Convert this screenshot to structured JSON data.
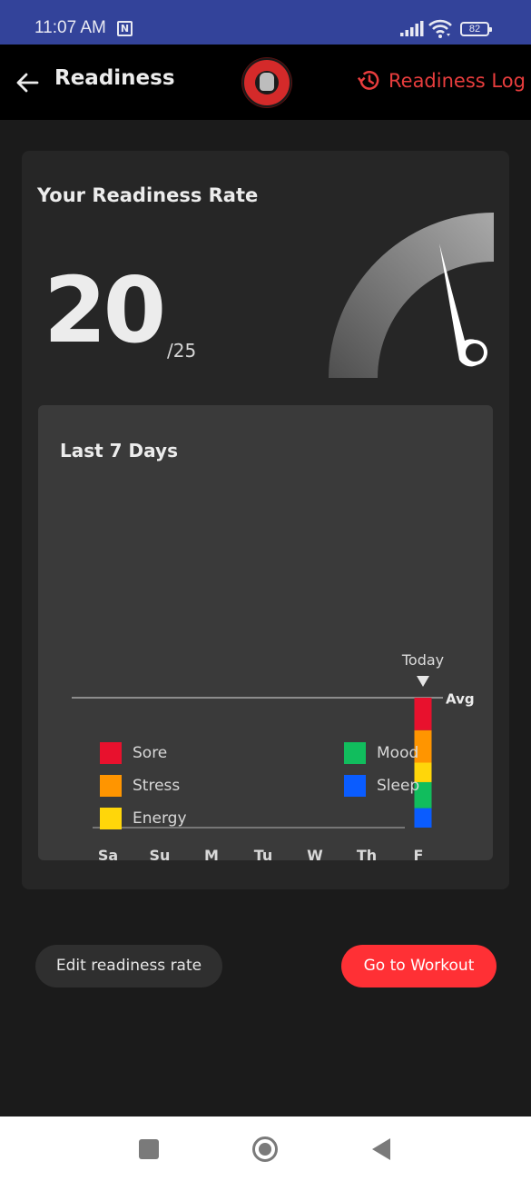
{
  "status_bar": {
    "time": "11:07 AM",
    "nfc_label": "N",
    "battery": "82"
  },
  "app_bar": {
    "title": "Readiness",
    "back_icon": "arrow-left-icon",
    "logo_alt": "Sweet Science of Fighting",
    "log_button": "Readiness Log",
    "log_icon": "history-icon",
    "accent_color": "#e83d3d"
  },
  "readiness": {
    "title": "Your Readiness Rate",
    "score": "20",
    "max_label": "/25",
    "score_value": 20,
    "max_value": 25
  },
  "chart_data": {
    "type": "bar",
    "title": "Last 7 Days",
    "categories": [
      "Sa",
      "Su",
      "M",
      "Tu",
      "W",
      "Th",
      "F"
    ],
    "stacked": true,
    "series": [
      {
        "name": "Sore",
        "color": "#e8112d",
        "values": [
          0,
          0,
          0,
          0,
          0,
          0,
          5
        ]
      },
      {
        "name": "Stress",
        "color": "#ff9500",
        "values": [
          0,
          0,
          0,
          0,
          0,
          0,
          5
        ]
      },
      {
        "name": "Energy",
        "color": "#ffd60a",
        "values": [
          0,
          0,
          0,
          0,
          0,
          0,
          3
        ]
      },
      {
        "name": "Mood",
        "color": "#11bd5d",
        "values": [
          0,
          0,
          0,
          0,
          0,
          0,
          4
        ]
      },
      {
        "name": "Sleep",
        "color": "#0a5cff",
        "values": [
          0,
          0,
          0,
          0,
          0,
          0,
          3
        ]
      }
    ],
    "stack_order_bottom_to_top": [
      "Sleep",
      "Mood",
      "Energy",
      "Stress",
      "Sore"
    ],
    "ylim": [
      0,
      20
    ],
    "avg_line": {
      "label": "Avg",
      "value": 20
    },
    "today_marker": {
      "label": "Today",
      "category": "F"
    },
    "legend": {
      "placement": "bottom",
      "entries": [
        {
          "label": "Sore",
          "color": "#e8112d"
        },
        {
          "label": "Stress",
          "color": "#ff9500"
        },
        {
          "label": "Energy",
          "color": "#ffd60a"
        },
        {
          "label": "Mood",
          "color": "#11bd5d"
        },
        {
          "label": "Sleep",
          "color": "#0a5cff"
        }
      ]
    },
    "grid": false
  },
  "actions": {
    "edit": "Edit readiness rate",
    "workout": "Go to Workout"
  }
}
